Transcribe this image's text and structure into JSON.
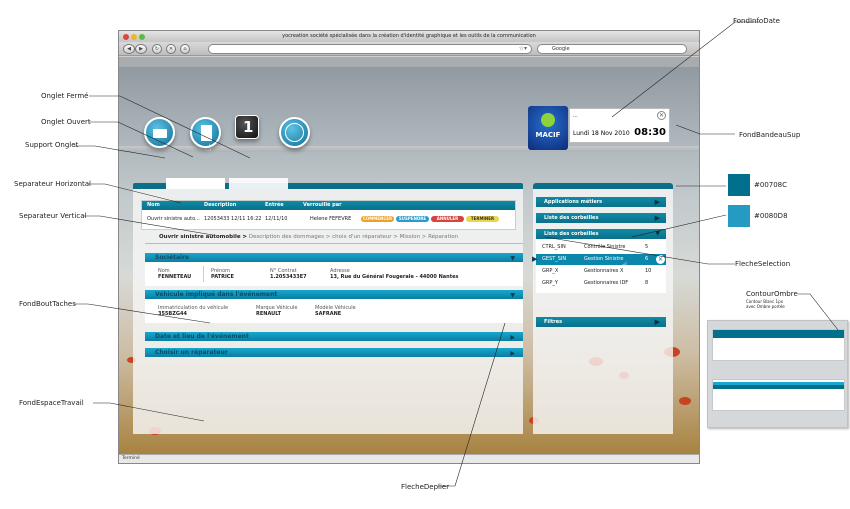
{
  "annotations": {
    "fond_info_date": "FondInfoDate",
    "onglet_ferme": "Onglet Fermé",
    "onglet_ouvert": "Onglet Ouvert",
    "support_onglet": "Support Onglet",
    "fond_bandeau_sup": "FondBandeauSup",
    "separateur_horizontal": "Separateur Horizontal",
    "separateur_vertical": "Separateur Vertical",
    "fond_bout_taches": "FondBoutTaches",
    "fond_espace_travail": "FondEspaceTravail",
    "fleche_deplier": "FlecheDeplier",
    "fleche_selection": "FlecheSelection",
    "contour_ombre": "ContourOmbre",
    "contour_ombre_note1": "Contour Blanc 1px",
    "contour_ombre_note2": "avec Ombre portée"
  },
  "swatches": [
    {
      "color": "#00708C",
      "label": "#00708C"
    },
    {
      "color": "#0080D8",
      "label": "#0080D8"
    }
  ],
  "browser": {
    "window_title": "yocreation société spécialisée dans la création d'identité graphique et les outils de la communication",
    "search_placeholder": "Google",
    "status": "Terminé"
  },
  "header": {
    "info_line": "...",
    "date": "Lundi 18 Nov 2010",
    "time": "08:30",
    "logo_text": "MACIF",
    "tab_icons": [
      "mail-icon",
      "document-icon",
      "calendar-icon",
      "globe-icon"
    ],
    "calendar_digit": "1"
  },
  "task_table": {
    "columns": [
      "Nom",
      "Description",
      "Entrée",
      "Verrouillé par"
    ],
    "row": {
      "nom": "Ouvrir sinistre auto...",
      "description": "12053433 12/11 16:22",
      "entree": "12/11/10",
      "verrouille": "Helene FEFEVRE"
    },
    "actions": [
      "COMMENCER",
      "SUSPENDRE",
      "ANNULER",
      "TERMINER"
    ],
    "action_colors": [
      "#f0a025",
      "#2a9bd0",
      "#d9433e",
      "#e9d64c"
    ]
  },
  "breadcrumb": {
    "current": "Ouvrir sinistre automobile",
    "sep": ">",
    "rest": "Description des dommages > choix d'un réparateur > Mission > Réparation"
  },
  "sections": {
    "societaire": {
      "title": "Sociétaire",
      "fields": [
        {
          "label": "Nom",
          "value": "FENNETEAU"
        },
        {
          "label": "Prénom",
          "value": "PATRICE"
        },
        {
          "label": "N° Contrat",
          "value": "1.2053433E7"
        },
        {
          "label": "Adresse",
          "value": "13, Rue du Général Fougerale - 44000 Nantes"
        }
      ]
    },
    "vehicule": {
      "title": "Véhicule impliqué dans l'événement",
      "fields": [
        {
          "label": "Immatriculation du véhicule",
          "value": "355BZG44"
        },
        {
          "label": "Marque Véhicule",
          "value": "RENAULT"
        },
        {
          "label": "Modèle Véhicule",
          "value": "SAFRANE"
        }
      ]
    },
    "date_lieu": {
      "title": "Date et lieu de l'événement"
    },
    "reparateur": {
      "title": "Choisir un réparateur"
    }
  },
  "right_panel": {
    "applications": "Applications métiers",
    "liste1": "Liste des corbeilles",
    "liste2": "Liste des corbeilles",
    "rows": [
      {
        "code": "CTRL_SIN",
        "name": "Contrôle Sinistre",
        "count": "5"
      },
      {
        "code": "GEST_SIN",
        "name": "Gestion Sinistre",
        "count": "6"
      },
      {
        "code": "GRP_X",
        "name": "Gestionnaires X",
        "count": "10"
      },
      {
        "code": "GRP_Y",
        "name": "Gestionnaires IDF",
        "count": "8"
      }
    ],
    "filtres": "Filtres"
  }
}
